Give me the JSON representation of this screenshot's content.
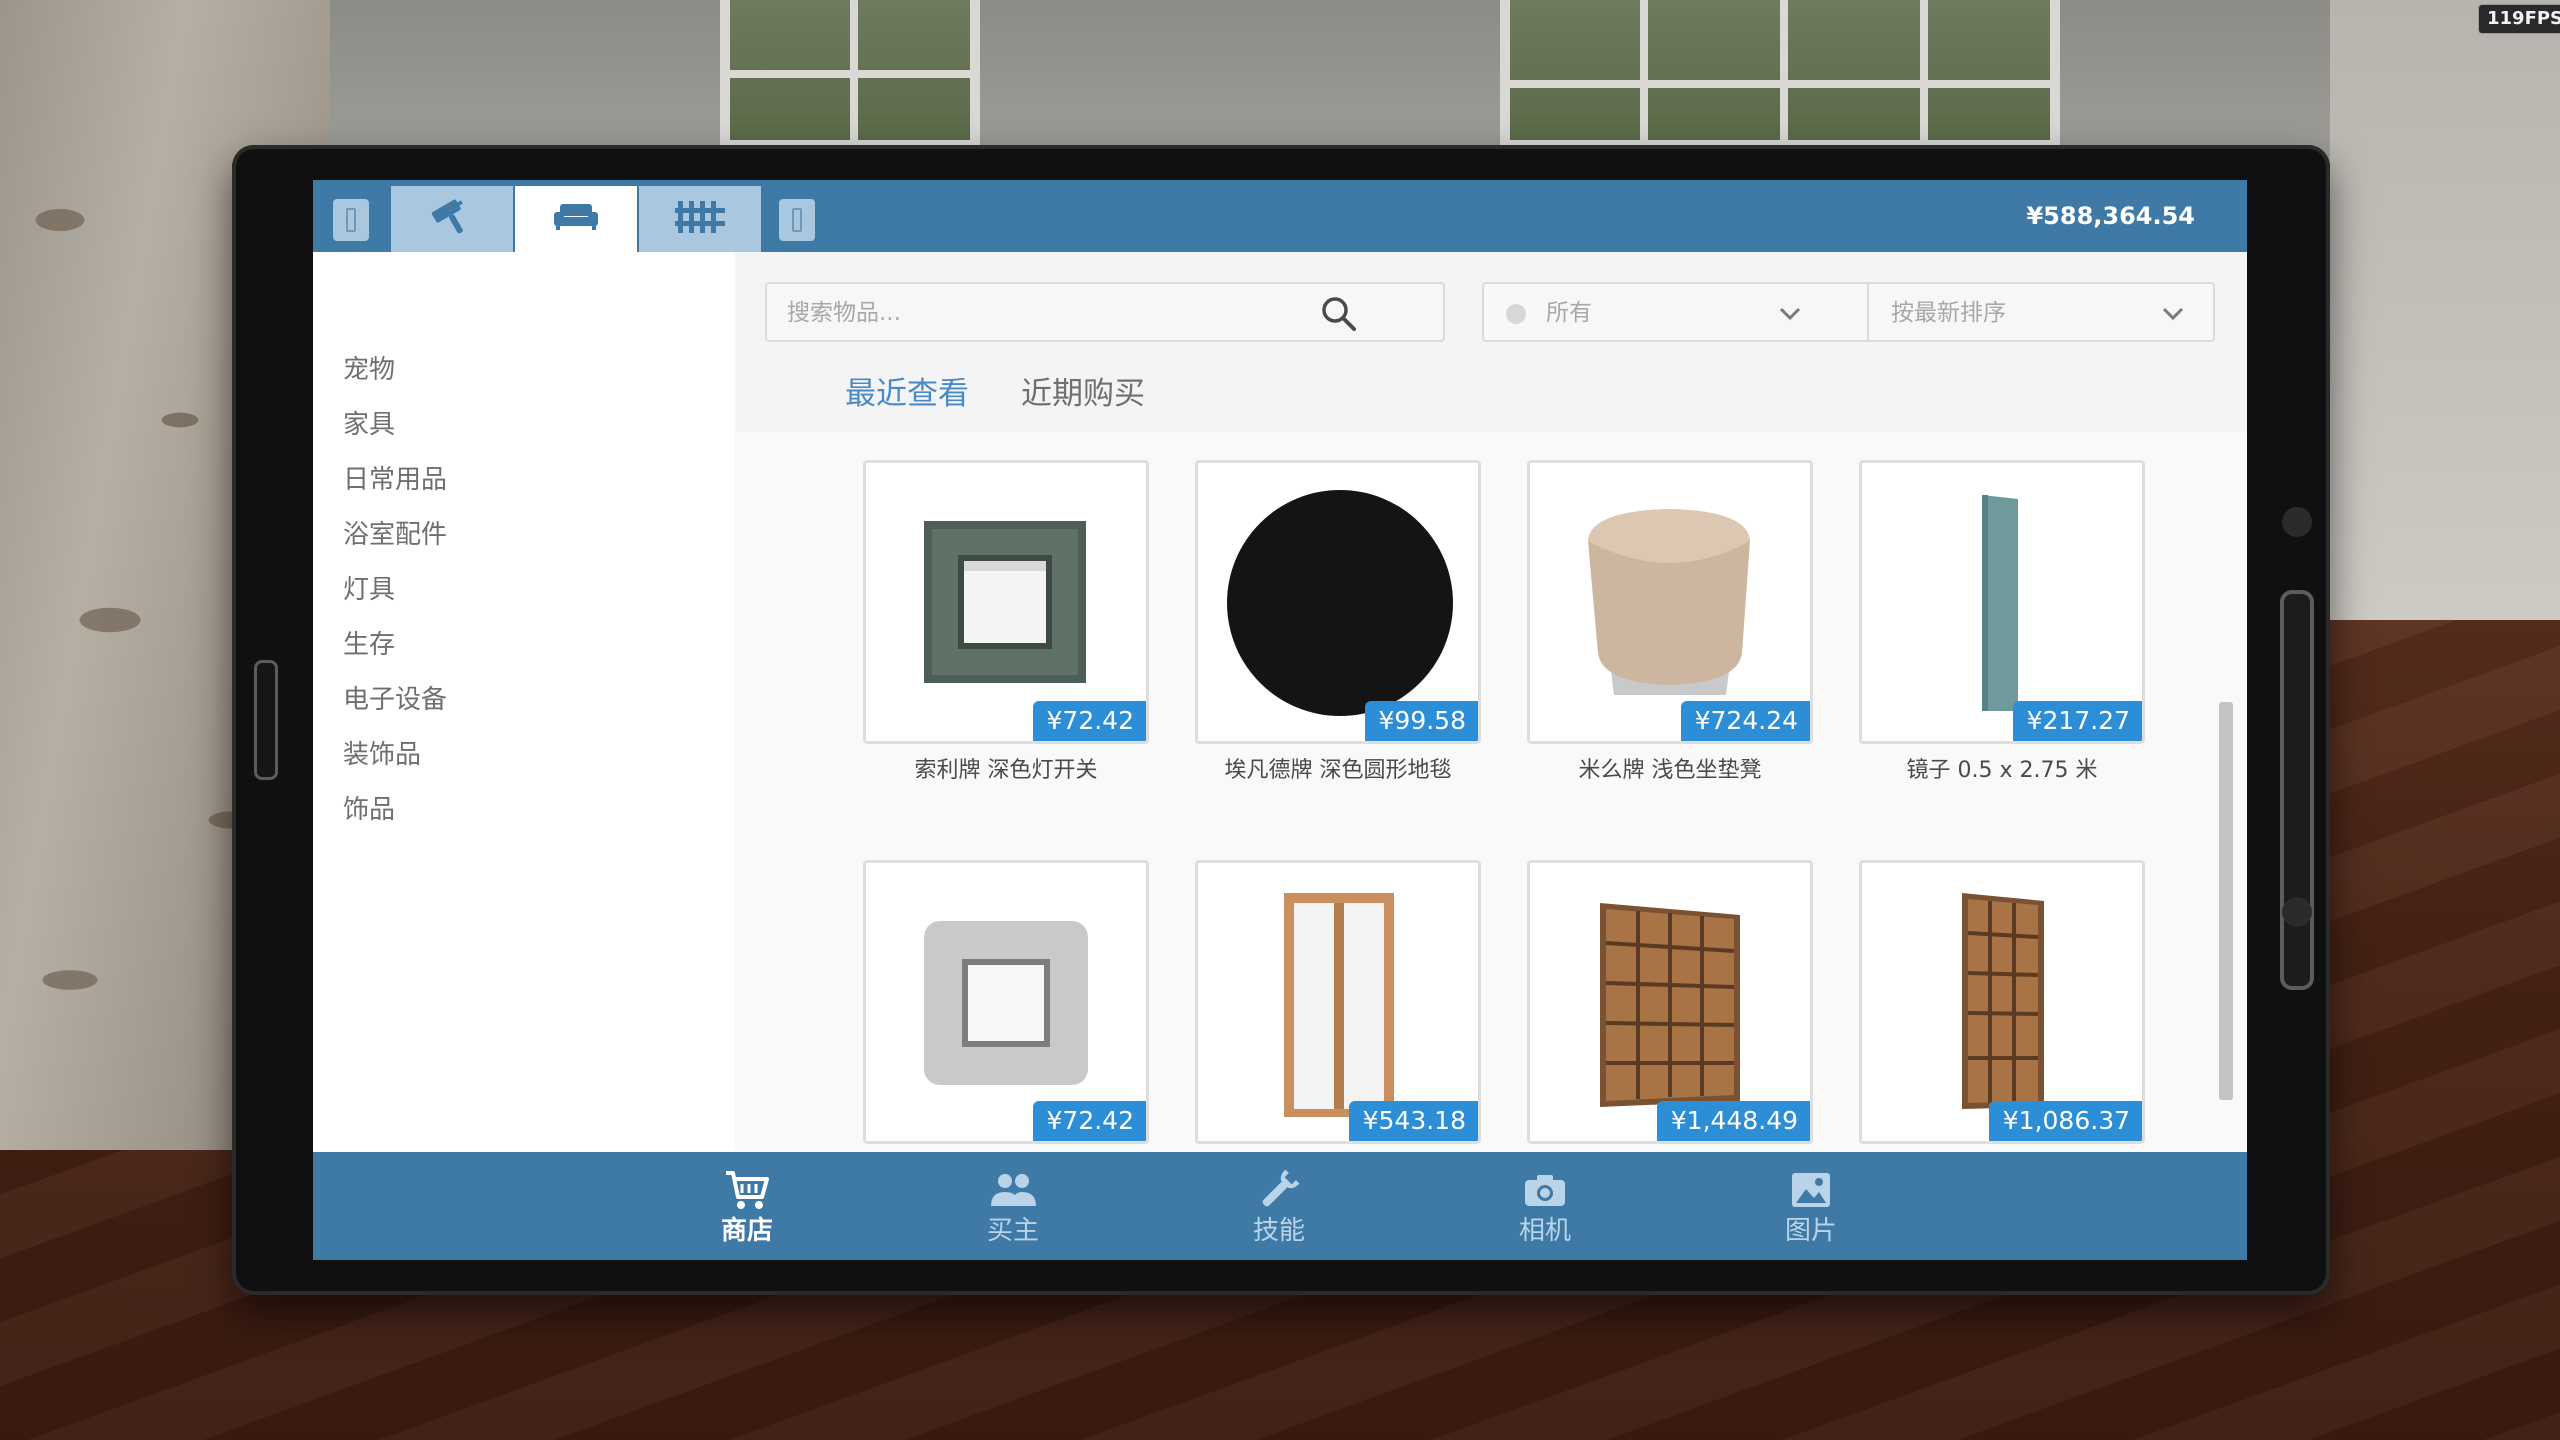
{
  "hud": {
    "fps": "119FPS"
  },
  "topbar": {
    "tabs": [
      {
        "icon": "paint-roller-icon"
      },
      {
        "icon": "sofa-icon"
      },
      {
        "icon": "fence-icon"
      }
    ],
    "money": "¥588,364.54"
  },
  "sidebar": {
    "categories": [
      "宠物",
      "家具",
      "日常用品",
      "浴室配件",
      "灯具",
      "生存",
      "电子设备",
      "装饰品",
      "饰品"
    ]
  },
  "filters": {
    "search_placeholder": "搜索物品...",
    "category_value": "所有",
    "sort_value": "按最新排序"
  },
  "subtabs": {
    "recent_viewed": "最近查看",
    "recent_purchased": "近期购买"
  },
  "products": [
    {
      "name": "索利牌 深色灯开关",
      "price": "¥72.42"
    },
    {
      "name": "埃凡德牌 深色圆形地毯",
      "price": "¥99.58"
    },
    {
      "name": "米么牌 浅色坐垫凳",
      "price": "¥724.24"
    },
    {
      "name": "镜子 0.5 x 2.75 米",
      "price": "¥217.27"
    },
    {
      "name": "",
      "price": "¥72.42"
    },
    {
      "name": "",
      "price": "¥543.18"
    },
    {
      "name": "",
      "price": "¥1,448.49"
    },
    {
      "name": "",
      "price": "¥1,086.37"
    }
  ],
  "bottom_nav": [
    {
      "label": "商店",
      "icon": "cart-icon"
    },
    {
      "label": "买主",
      "icon": "people-icon"
    },
    {
      "label": "技能",
      "icon": "wrench-icon"
    },
    {
      "label": "相机",
      "icon": "camera-icon"
    },
    {
      "label": "图片",
      "icon": "image-icon"
    }
  ],
  "colors": {
    "accent": "#3f7aa7",
    "price_badge": "#2b8ed6",
    "active_subtab": "#4b89c6"
  }
}
